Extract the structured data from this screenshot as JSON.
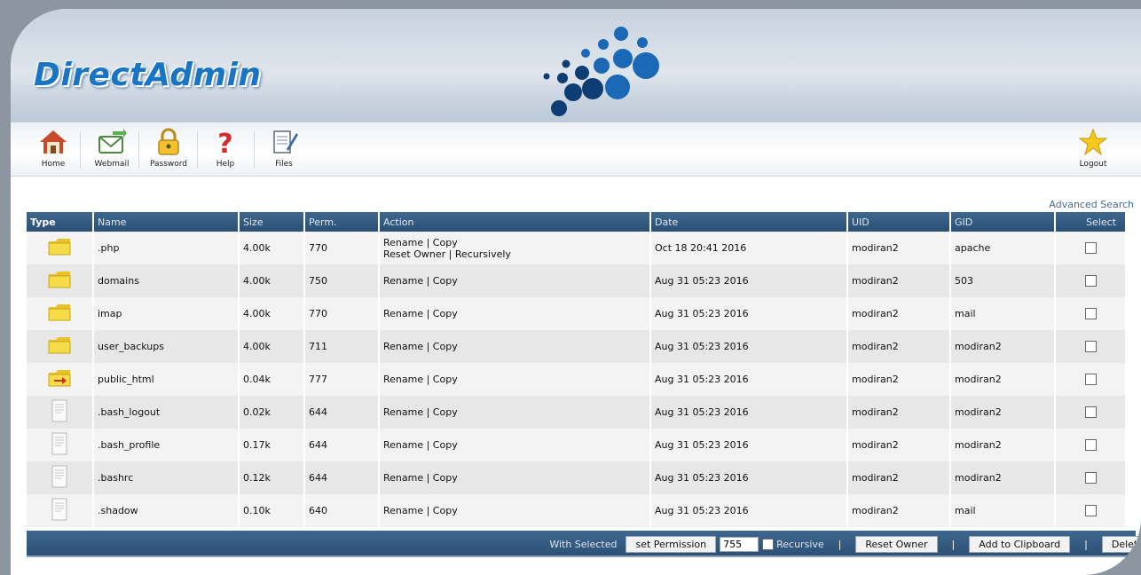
{
  "brand": {
    "name": "DirectAdmin"
  },
  "toolbar": {
    "items": [
      {
        "label": "Home",
        "icon": "home-icon"
      },
      {
        "label": "Webmail",
        "icon": "webmail-icon"
      },
      {
        "label": "Password",
        "icon": "lock-icon"
      },
      {
        "label": "Help",
        "icon": "help-icon"
      },
      {
        "label": "Files",
        "icon": "files-icon"
      }
    ],
    "logout": {
      "label": "Logout",
      "icon": "star-icon"
    }
  },
  "advanced_search": "Advanced Search",
  "table": {
    "headers": [
      "Type",
      "Name",
      "Size",
      "Perm.",
      "Action",
      "Date",
      "UID",
      "GID",
      "Select"
    ],
    "rows": [
      {
        "type": "folder",
        "name": ".php",
        "size": "4.00k",
        "perm": "770",
        "action1": "Rename | Copy",
        "action2": "Reset Owner | Recursively",
        "date": "Oct 18 20:41 2016",
        "uid": "modiran2",
        "gid": "apache"
      },
      {
        "type": "folder",
        "name": "domains",
        "size": "4.00k",
        "perm": "750",
        "action1": "Rename | Copy",
        "date": "Aug 31 05:23 2016",
        "uid": "modiran2",
        "gid": "503"
      },
      {
        "type": "folder",
        "name": "imap",
        "size": "4.00k",
        "perm": "770",
        "action1": "Rename | Copy",
        "date": "Aug 31 05:23 2016",
        "uid": "modiran2",
        "gid": "mail"
      },
      {
        "type": "folder",
        "name": "user_backups",
        "size": "4.00k",
        "perm": "711",
        "action1": "Rename | Copy",
        "date": "Aug 31 05:23 2016",
        "uid": "modiran2",
        "gid": "modiran2"
      },
      {
        "type": "link-folder",
        "name": "public_html",
        "size": "0.04k",
        "perm": "777",
        "action1": "Rename | Copy",
        "date": "Aug 31 05:23 2016",
        "uid": "modiran2",
        "gid": "modiran2"
      },
      {
        "type": "file",
        "name": ".bash_logout",
        "size": "0.02k",
        "perm": "644",
        "action1": "Rename | Copy",
        "date": "Aug 31 05:23 2016",
        "uid": "modiran2",
        "gid": "modiran2"
      },
      {
        "type": "file",
        "name": ".bash_profile",
        "size": "0.17k",
        "perm": "644",
        "action1": "Rename | Copy",
        "date": "Aug 31 05:23 2016",
        "uid": "modiran2",
        "gid": "modiran2"
      },
      {
        "type": "file",
        "name": ".bashrc",
        "size": "0.12k",
        "perm": "644",
        "action1": "Rename | Copy",
        "date": "Aug 31 05:23 2016",
        "uid": "modiran2",
        "gid": "modiran2"
      },
      {
        "type": "file",
        "name": ".shadow",
        "size": "0.10k",
        "perm": "640",
        "action1": "Rename | Copy",
        "date": "Aug 31 05:23 2016",
        "uid": "modiran2",
        "gid": "mail"
      }
    ]
  },
  "footer": {
    "with_selected": "With Selected",
    "set_permission": "set Permission",
    "perm_value": "755",
    "recursive": "Recursive",
    "reset_owner": "Reset Owner",
    "add_clipboard": "Add to Clipboard",
    "delete": "Delete"
  },
  "colors": {
    "header_bar": "#2b4f75",
    "brand_blue": "#1a74c4",
    "folder": "#f2d23a"
  }
}
